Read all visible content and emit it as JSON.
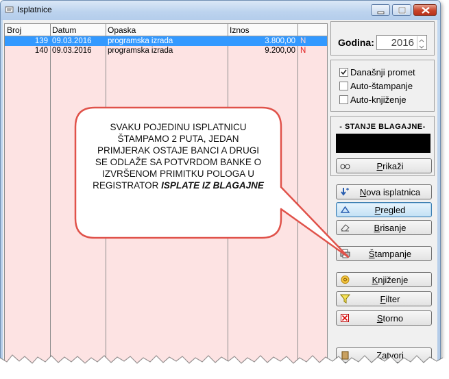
{
  "window": {
    "title": "Isplatnice"
  },
  "table": {
    "columns": [
      "Broj",
      "Datum",
      "Opaska",
      "Iznos"
    ],
    "rows": [
      {
        "broj": "139",
        "datum": "09.03.2016",
        "opaska": "programska izrada",
        "iznos": "3.800,00",
        "status": "N",
        "selected": true
      },
      {
        "broj": "140",
        "datum": "09.03.2016",
        "opaska": "programska izrada",
        "iznos": "9.200,00",
        "status": "N",
        "selected": false
      }
    ]
  },
  "panel": {
    "godina_label": "Godina:",
    "godina_value": "2016",
    "checkboxes": [
      {
        "label": "Današnji promet",
        "checked": true
      },
      {
        "label": "Auto-štampanje",
        "checked": false
      },
      {
        "label": "Auto-knjiženje",
        "checked": false
      }
    ],
    "stanje_title": "- STANJE BLAGAJNE-",
    "buttons": {
      "prikazi": "Prikaži",
      "nova": "Nova isplatnica",
      "pregled": "Pregled",
      "brisanje": "Brisanje",
      "stampanje": "Štampanje",
      "knjizenje": "Knjiženje",
      "filter": "Filter",
      "storno": "Storno",
      "zatvori": "Zatvori"
    }
  },
  "callout": {
    "text": "SVAKU POJEDINU ISPLATNICU ŠTAMPAMO 2 PUTA, JEDAN PRIMJERAK OSTAJE BANCI A DRUGI SE ODLAŽE SA POTVRDOM BANKE O IZVRŠENOM PRIMITKU POLOGA U REGISTRATOR",
    "bold_text": "ISPLATE IZ BLAGAJNE"
  },
  "colors": {
    "selection": "#3399ff",
    "grid_bg": "#fde3e3",
    "callout_border": "#e0524a",
    "status_n": "#e02020"
  }
}
